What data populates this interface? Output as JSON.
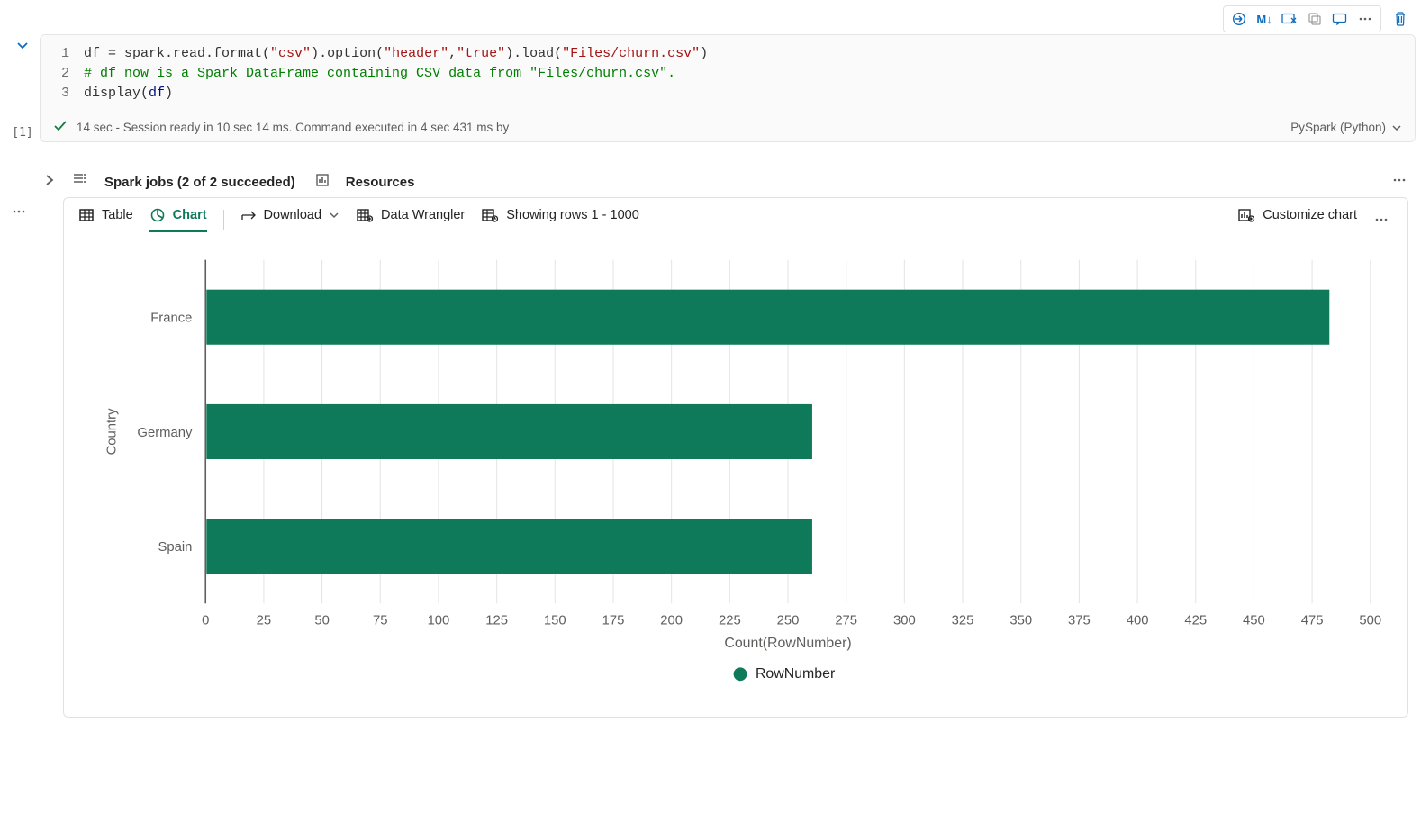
{
  "toolbar": {
    "markdown_label": "M↓"
  },
  "code": {
    "line_numbers": [
      "1",
      "2",
      "3"
    ],
    "line1_pre": "df = spark.read.format(",
    "line1_s1": "\"csv\"",
    "line1_mid1": ").option(",
    "line1_s2": "\"header\"",
    "line1_comma": ",",
    "line1_s3": "\"true\"",
    "line1_mid2": ").load(",
    "line1_s4": "\"Files/churn.csv\"",
    "line1_end": ")",
    "line2": "# df now is a Spark DataFrame containing CSV data from \"Files/churn.csv\".",
    "line3_pre": "display(",
    "line3_id": "df",
    "line3_end": ")"
  },
  "status": {
    "exec_label": "[1]",
    "text": "14 sec - Session ready in 10 sec 14 ms. Command executed in 4 sec 431 ms by",
    "language": "PySpark (Python)"
  },
  "below": {
    "spark_jobs": "Spark jobs (2 of 2 succeeded)",
    "resources": "Resources"
  },
  "output_toolbar": {
    "table": "Table",
    "chart": "Chart",
    "download": "Download",
    "wrangler": "Data Wrangler",
    "rows": "Showing rows 1 - 1000",
    "customize": "Customize chart"
  },
  "chart_data": {
    "type": "bar",
    "orientation": "horizontal",
    "ylabel": "Country",
    "xlabel": "Count(RowNumber)",
    "legend": "RowNumber",
    "categories": [
      "France",
      "Germany",
      "Spain"
    ],
    "values": [
      482,
      260,
      260
    ],
    "xlim": [
      0,
      500
    ],
    "ticks": [
      0,
      25,
      50,
      75,
      100,
      125,
      150,
      175,
      200,
      225,
      250,
      275,
      300,
      325,
      350,
      375,
      400,
      425,
      450,
      475,
      500
    ]
  }
}
